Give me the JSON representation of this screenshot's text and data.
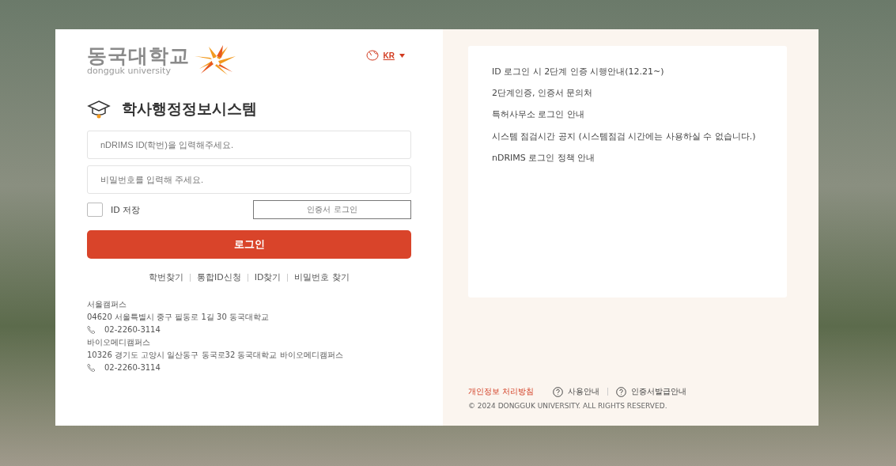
{
  "logo": {
    "name": "동국대학교",
    "subtitle": "dongguk university"
  },
  "language": {
    "label": "KR"
  },
  "system_title": "학사행정정보시스템",
  "login_form": {
    "id_field": {
      "placeholder": "nDRIMS ID(학번)을 입력해주세요."
    },
    "password_field": {
      "placeholder": "비밀번호를 입력해 주세요."
    },
    "save_id": {
      "label": "ID 저장",
      "checked": false
    },
    "cert_login_button": "인증서 로그인",
    "login_button": "로그인"
  },
  "links": [
    "학번찾기",
    "통합ID신청",
    "ID찾기",
    "비밀번호 찾기"
  ],
  "campuses": [
    {
      "name": "서울캠퍼스",
      "address": "04620 서울특별시 중구 필동로 1길 30 동국대학교",
      "phone": "02-2260-3114"
    },
    {
      "name": "바이오메디캠퍼스",
      "address": "10326 경기도 고양시 일산동구 동국로32 동국대학교 바이오메디캠퍼스",
      "phone": "02-2260-3114"
    }
  ],
  "notices": [
    "ID 로그인 시 2단계 인증 시행안내(12.21~)",
    "2단계인증, 인증서 문의처",
    "특허사무소 로그인 안내",
    "시스템 점검시간 공지 (시스템점검 시간에는 사용하실 수 없습니다.)",
    "nDRIMS 로그인 정책 안내"
  ],
  "footer": {
    "privacy_link": "개인정보 처리방침",
    "help_links": [
      "사용안내",
      "인증서발급안내"
    ],
    "copyright": "© 2024 DONGGUK UNIVERSITY. ALL RIGHTS RESERVED."
  }
}
